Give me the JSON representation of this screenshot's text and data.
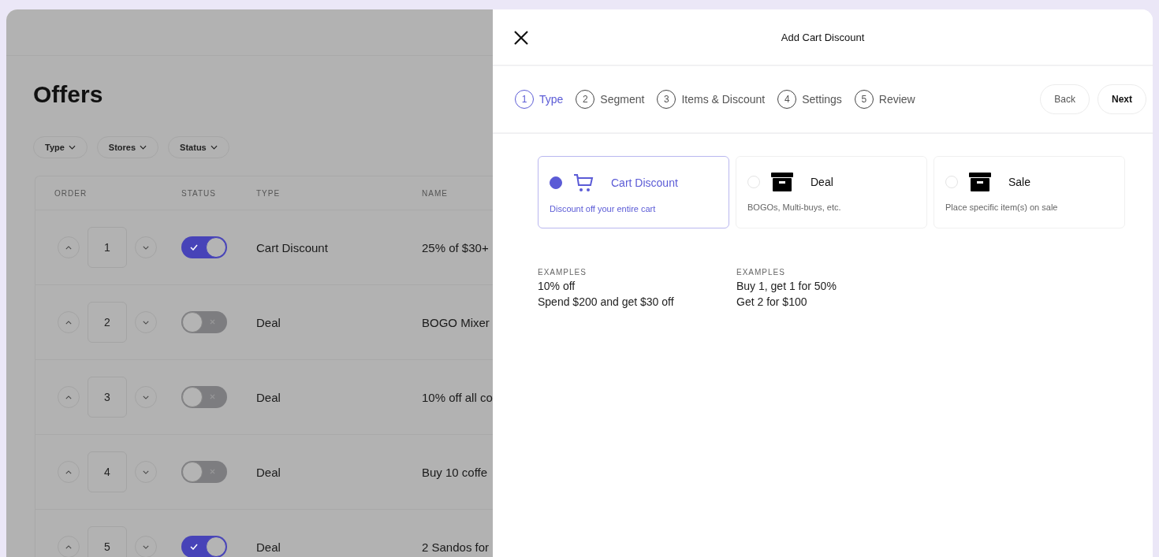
{
  "page": {
    "title": "Offers"
  },
  "filters": [
    "Type",
    "Stores",
    "Status"
  ],
  "table": {
    "columns": [
      "ORDER",
      "STATUS",
      "TYPE",
      "NAME"
    ],
    "rows": [
      {
        "order": "1",
        "enabled": true,
        "type": "Cart Discount",
        "name": "25% of $30+"
      },
      {
        "order": "2",
        "enabled": false,
        "type": "Deal",
        "name": "BOGO Mixer"
      },
      {
        "order": "3",
        "enabled": false,
        "type": "Deal",
        "name": "10% off all co"
      },
      {
        "order": "4",
        "enabled": false,
        "type": "Deal",
        "name": "Buy 10 coffe"
      },
      {
        "order": "5",
        "enabled": true,
        "type": "Deal",
        "name": "2 Sandos for"
      }
    ]
  },
  "drawer": {
    "title": "Add Cart Discount",
    "steps": [
      {
        "number": "1",
        "label": "Type",
        "selected": true
      },
      {
        "number": "2",
        "label": "Segment",
        "selected": false
      },
      {
        "number": "3",
        "label": "Items & Discount",
        "selected": false
      },
      {
        "number": "4",
        "label": "Settings",
        "selected": false
      },
      {
        "number": "5",
        "label": "Review",
        "selected": false
      }
    ],
    "buttons": {
      "back": "Back",
      "next": "Next"
    },
    "options": [
      {
        "kind": "cart",
        "title": "Cart Discount",
        "description": "Discount off your entire cart",
        "selected": true
      },
      {
        "kind": "box",
        "title": "Deal",
        "description": "BOGOs, Multi-buys, etc.",
        "selected": false
      },
      {
        "kind": "box",
        "title": "Sale",
        "description": "Place specific item(s) on sale",
        "selected": false
      }
    ],
    "examples": [
      {
        "heading": "EXAMPLES",
        "lines": [
          "10% off",
          "Spend $200 and get $30 off"
        ]
      },
      {
        "heading": "EXAMPLES",
        "lines": [
          "Buy 1, get 1 for 50%",
          "Get 2 for $100"
        ]
      }
    ]
  }
}
